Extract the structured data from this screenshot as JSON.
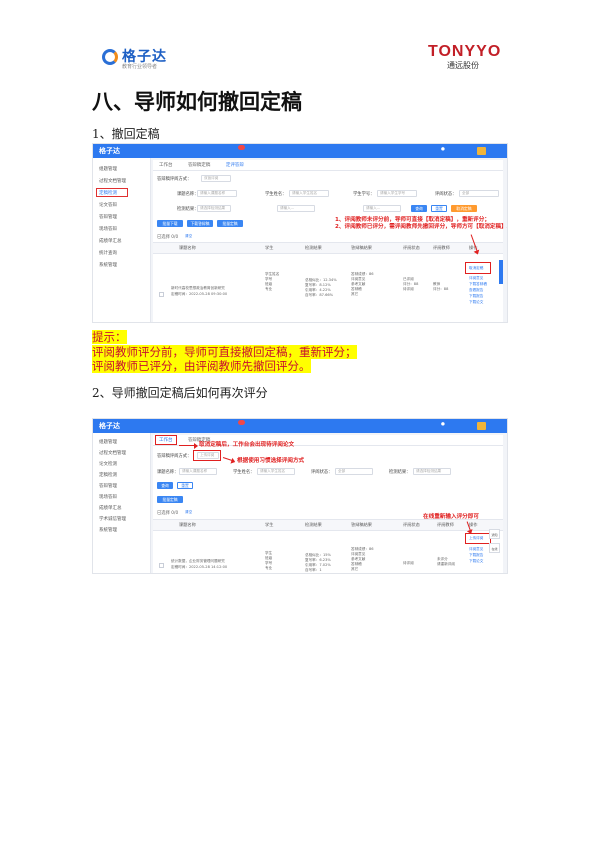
{
  "header": {
    "left_logo_name": "格子达",
    "left_logo_slogan": "教育行业领导者",
    "right_logo_name": "TONYYO",
    "right_logo_sub": "通远股份"
  },
  "title": "八、导师如何撤回定稿",
  "section1": "1、撤回定稿",
  "tips": {
    "label": "提示：",
    "line1": "评阅教师评分前，导师可直接撤回定稿，重新评分；",
    "line2": "评阅教师已评分，由评阅教师先撤回评分。"
  },
  "section2": "2、导师撤回定稿后如何再次评分",
  "shot1": {
    "app_logo": "格子达",
    "tabs": [
      "工作台",
      "答辩稿定稿",
      "定评答辩"
    ],
    "sidebar": [
      "组题管理",
      "过程文档管理",
      "定稿检测",
      "论文答辩",
      "答辩管理",
      "现场答辩",
      "成绩单汇总",
      "统计查询",
      "系统管理"
    ],
    "filters": {
      "method_label": "答辩稿评阅方式：",
      "method_value": "双盲评阅",
      "title_label": "课题名称：",
      "title_ph": "请输入课题名称",
      "student_label": "学生姓名：",
      "student_ph": "请输入学生姓名",
      "sno_label": "学生学号：",
      "sno_ph": "请输入学生学号",
      "status_label": "评阅状态：",
      "status_value": "全部",
      "result_label": "检测结果：",
      "result_ph": "请选择检测结果",
      "input_ph": "请输入..."
    },
    "buttons": [
      "批量下载",
      "下载答辩稿",
      "批量定稿",
      "查询",
      "重置",
      "取消定稿"
    ],
    "selected": "已选择 0/0",
    "clear": "清空",
    "notes": [
      "1、评阅教师未评分前，导师可直接【取消定稿】，重新评分；",
      "2、评阅教师已评分，需评阅教师先撤回评分，导师方可【取消定稿】。"
    ],
    "columns": [
      "课题名称",
      "学生",
      "检测结果",
      "答辩稿结果",
      "评阅状态",
      "评阅教师",
      "操作"
    ],
    "row": {
      "topic": "新时代高校思想政治教育创新研究",
      "time": "定稿时间：2022-05-28 09:30:00",
      "student": [
        "学生姓名",
        "学号",
        "班级",
        "专业"
      ],
      "check": [
        "总相似比：12.34%",
        "复写率：8.12%",
        "引用率：4.22%",
        "自写率：87.66%"
      ],
      "grade": [
        "答辩成绩：86",
        "评阅意见",
        "参考文献",
        "答辩稿",
        "其它"
      ],
      "status": [
        "已评阅",
        "评分：88",
        "待评阅"
      ],
      "teacher": [
        "教师",
        "评分：88"
      ],
      "ops": [
        "取消定稿",
        "评阅意见",
        "下载答辩稿",
        "查看报告",
        "下载报告",
        "下载论文"
      ]
    }
  },
  "shot2": {
    "app_logo": "格子达",
    "tabs": [
      "工作台",
      "答辩稿定稿"
    ],
    "sidebar": [
      "组题管理",
      "过程文档管理",
      "论文检测",
      "定稿检测",
      "答辩管理",
      "现场答辩",
      "成绩单汇总",
      "学术诚信管理",
      "系统管理"
    ],
    "notes": [
      "取消定稿后，工作台会出现待评阅论文",
      "根据使用习惯选择评阅方式",
      "在线重新输入评分即可"
    ],
    "filters": {
      "method_label": "答辩稿评阅方式：",
      "method_value": "上传评阅",
      "title_label": "课题名称：",
      "title_ph": "请输入课题名称",
      "student_label": "学生姓名：",
      "student_ph": "请输入学生姓名",
      "status_label": "评阅状态：",
      "status_value": "全部",
      "result_label": "检测结果：",
      "result_ph": "请选择检测结果"
    },
    "buttons": [
      "查询",
      "重置",
      "批量定稿"
    ],
    "selected": "已选择 0/0",
    "clear": "清空",
    "columns": [
      "课题名称",
      "学生",
      "检测结果",
      "答辩稿结果",
      "评阅状态",
      "评阅教师",
      "操作"
    ],
    "row": {
      "topic": "统计数据，企业财务管理问题研究",
      "time": "定稿时间：2022-05-28 14:12:00",
      "student": [
        "学生",
        "班级",
        "学号",
        "专业"
      ],
      "check": [
        "总相似比：15%",
        "复写率：6.23%",
        "引用率：7.02%",
        "自写率：1"
      ],
      "grade": [
        "答辩成绩：86",
        "评阅意见",
        "参考文献",
        "答辩稿",
        "其它"
      ],
      "status": [
        "待评阅"
      ],
      "teacher": [
        "未评分",
        "请重新评阅"
      ],
      "ops": [
        "上传评阅",
        "评阅意见",
        "下载报告",
        "下载论文"
      ]
    },
    "float": [
      "通知",
      "在线"
    ]
  }
}
